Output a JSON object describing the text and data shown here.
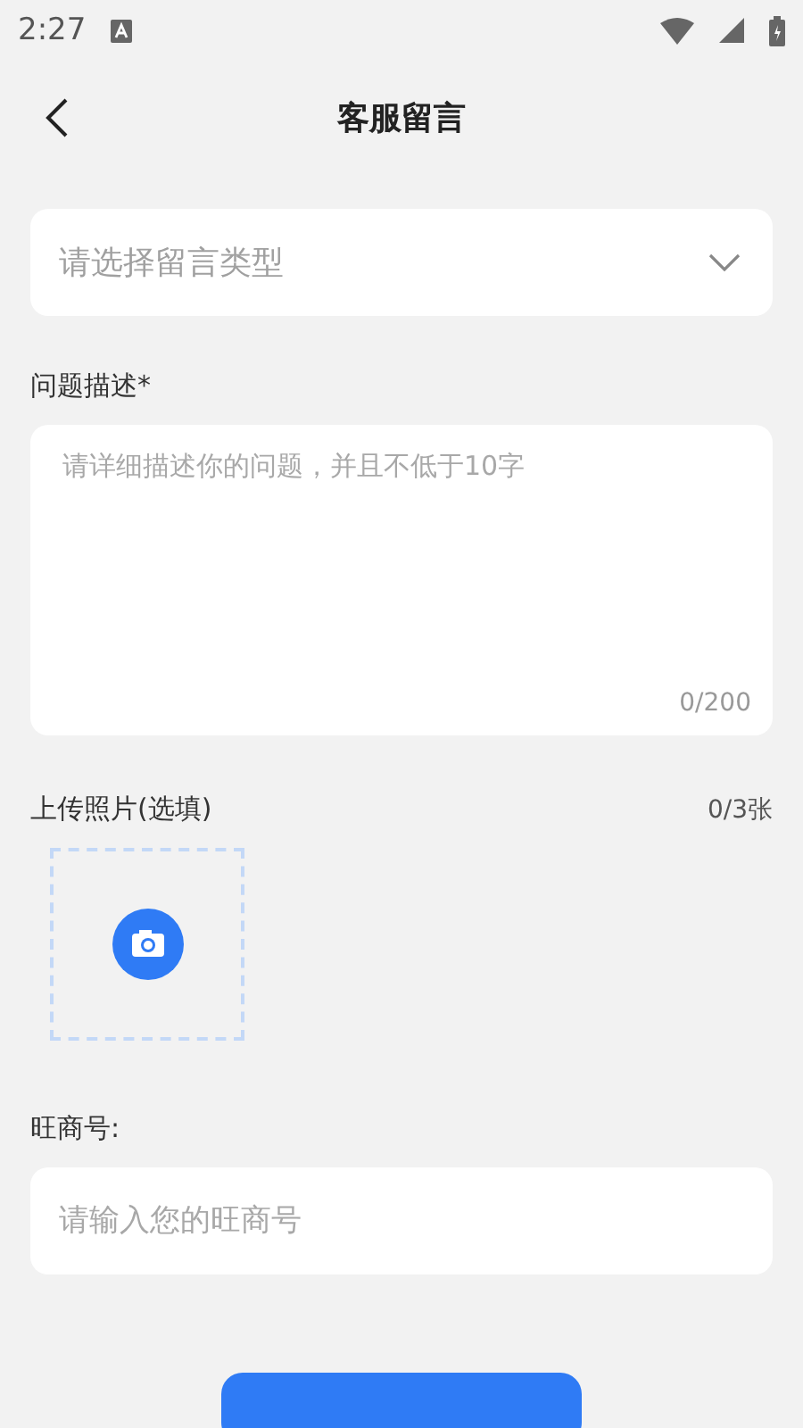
{
  "status_bar": {
    "time": "2:27"
  },
  "header": {
    "title": "客服留言"
  },
  "type_select": {
    "placeholder": "请选择留言类型"
  },
  "description": {
    "label": "问题描述*",
    "placeholder": "请详细描述你的问题，并且不低于10字",
    "counter": "0/200"
  },
  "photos": {
    "label": "上传照片(选填)",
    "counter": "0/3张"
  },
  "account": {
    "label": "旺商号:",
    "placeholder": "请输入您的旺商号"
  }
}
